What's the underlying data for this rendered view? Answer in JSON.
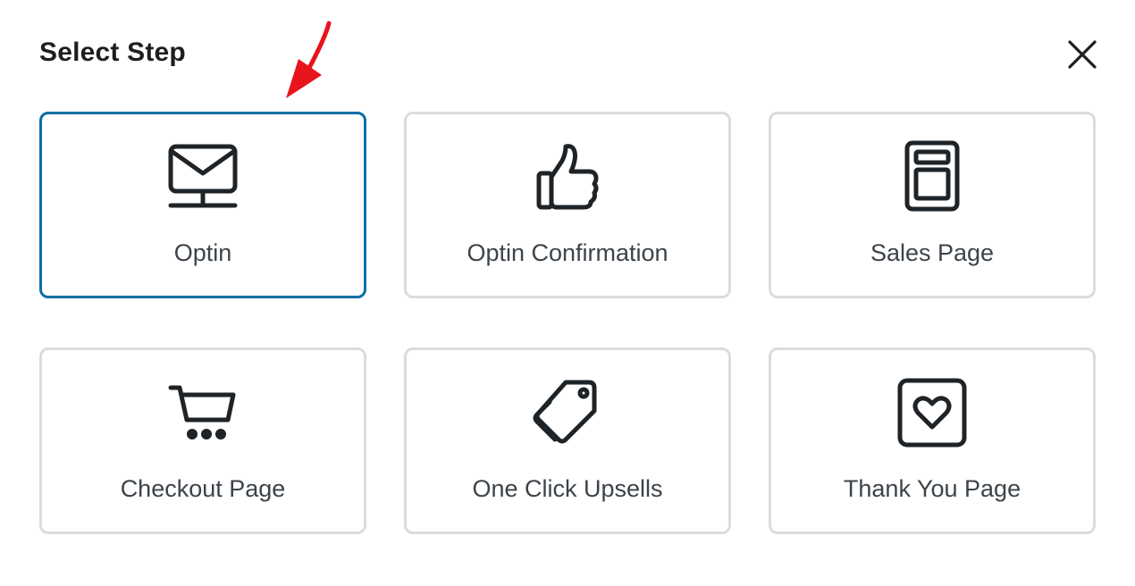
{
  "dialog": {
    "title": "Select Step",
    "close_icon": "close-icon"
  },
  "steps": [
    {
      "label": "Optin",
      "icon": "envelope-monitor-icon",
      "selected": true
    },
    {
      "label": "Optin Confirmation",
      "icon": "thumbs-up-icon",
      "selected": false
    },
    {
      "label": "Sales Page",
      "icon": "page-layout-icon",
      "selected": false
    },
    {
      "label": "Checkout Page",
      "icon": "cart-icon",
      "selected": false
    },
    {
      "label": "One Click Upsells",
      "icon": "tags-icon",
      "selected": false
    },
    {
      "label": "Thank You Page",
      "icon": "heart-box-icon",
      "selected": false
    }
  ],
  "colors": {
    "selected_border": "#0a6ea6",
    "card_border": "#dcdcde",
    "annotation_arrow": "#e8141c",
    "icon": "#1e2327"
  }
}
